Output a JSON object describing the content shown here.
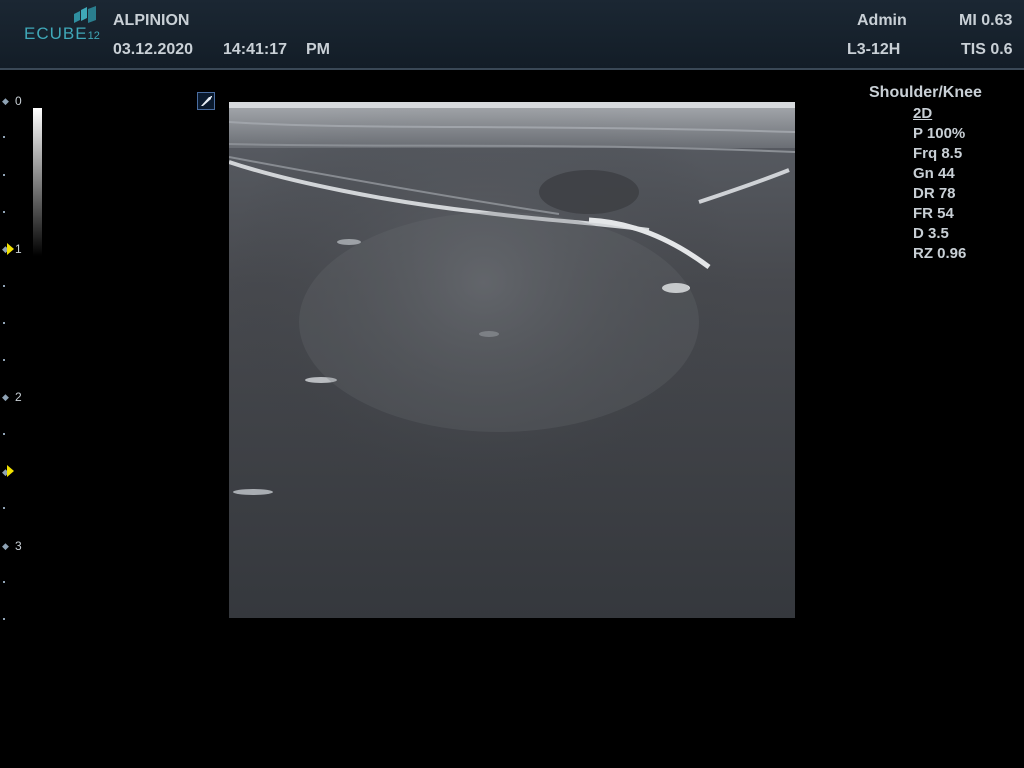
{
  "header": {
    "logo": {
      "brand": "ECUBE",
      "model": "12",
      "icon": "ecube-logo-icon"
    },
    "manufacturer": "ALPINION",
    "date": "03.12.2020",
    "time": "14:41:17",
    "ampm": "PM",
    "user": "Admin",
    "probe": "L3-12H",
    "mi": "MI 0.63",
    "tis": "TIS 0.6"
  },
  "depth_scale": {
    "labels": [
      "0",
      "1",
      "2",
      "3"
    ]
  },
  "orientation_marker": {
    "icon": "probe-orientation-icon"
  },
  "parameters": {
    "preset": "Shoulder/Knee",
    "mode": "2D",
    "items": [
      "P 100%",
      "Frq 8.5",
      "Gn 44",
      "DR 78",
      "FR 54",
      "D 3.5",
      "RZ 0.96"
    ]
  },
  "colors": {
    "header_bg": "#17222d",
    "logo_accent": "#3fa8b8",
    "focus_marker": "#f2e200",
    "text": "#c9d0d6"
  }
}
